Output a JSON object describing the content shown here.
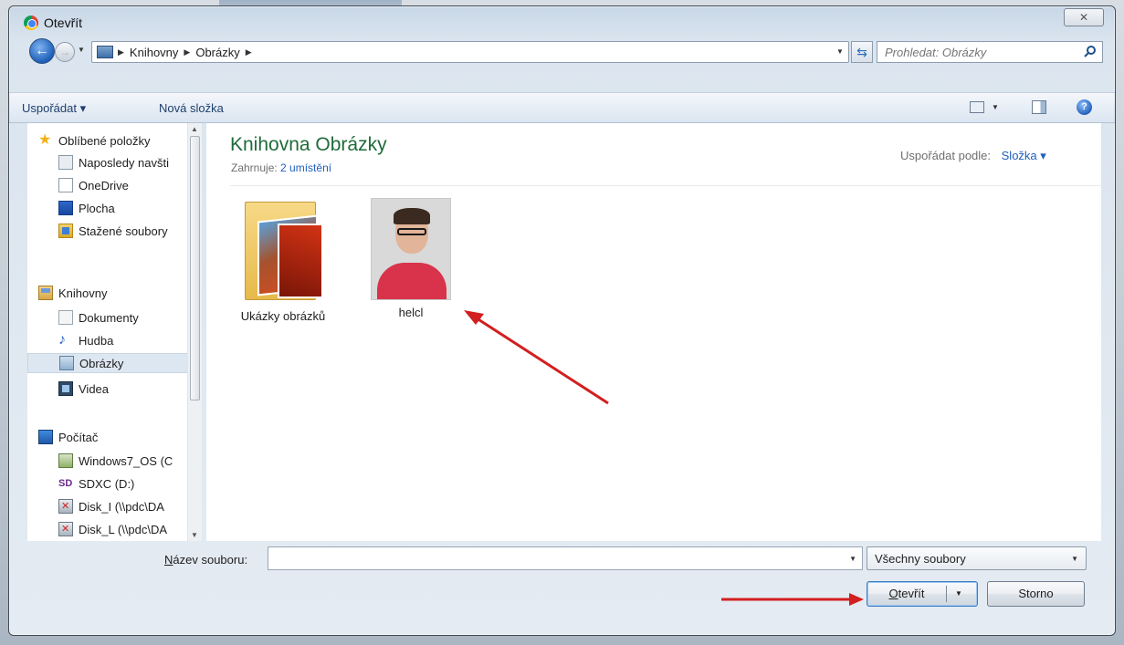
{
  "window": {
    "title": "Otevřít",
    "close_glyph": "✕"
  },
  "address": {
    "crumbs": [
      "Knihovny",
      "Obrázky"
    ],
    "search_placeholder": "Prohledat: Obrázky"
  },
  "toolbar": {
    "organize_label": "Uspořádat ▾",
    "new_folder_label": "Nová složka"
  },
  "nav": {
    "favorites": {
      "label": "Oblíbené položky",
      "items": [
        "Naposledy navšti",
        "OneDrive",
        "Plocha",
        "Stažené soubory"
      ]
    },
    "libraries": {
      "label": "Knihovny",
      "items": [
        "Dokumenty",
        "Hudba",
        "Obrázky",
        "Videa"
      ],
      "selected": "Obrázky"
    },
    "computer": {
      "label": "Počítač",
      "items": [
        "Windows7_OS (C",
        "SDXC (D:)",
        "Disk_I (\\\\pdc\\DA",
        "Disk_L (\\\\pdc\\DA"
      ]
    }
  },
  "content": {
    "title": "Knihovna Obrázky",
    "includes_label": "Zahrnuje:",
    "includes_link": "2 umístění",
    "arrange_label": "Uspořádat podle:",
    "arrange_value": "Složka ▾",
    "items": [
      {
        "label": "Ukázky obrázků",
        "kind": "folder"
      },
      {
        "label": "helcl",
        "kind": "image"
      }
    ]
  },
  "footer": {
    "filename_label_prefix": "N",
    "filename_label_rest": "ázev souboru:",
    "filename_value": "",
    "filter_value": "Všechny soubory",
    "open_label": "Otevřít",
    "cancel_label": "Storno"
  },
  "colors": {
    "annotation": "#d21f1f",
    "title_green": "#1e6b3a",
    "link_blue": "#1f5fbf"
  }
}
